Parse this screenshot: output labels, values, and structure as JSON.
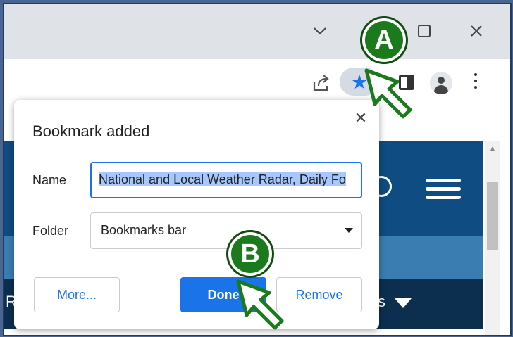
{
  "window": {
    "controls": {
      "collapse_icon": "chevron-down-icon",
      "maximize_icon": "square-icon",
      "close_icon": "close-icon"
    }
  },
  "toolbar": {
    "icons": [
      "share-icon",
      "star-icon",
      "side-panel-icon",
      "profile-icon",
      "more-vert-icon"
    ]
  },
  "page": {
    "nav_left_text": "Ra",
    "nav_right_text": "s"
  },
  "dialog": {
    "title": "Bookmark added",
    "name_label": "Name",
    "name_value": "National and Local Weather Radar, Daily Fo",
    "folder_label": "Folder",
    "folder_value": "Bookmarks bar",
    "buttons": {
      "more": "More...",
      "done": "Done",
      "remove": "Remove"
    }
  },
  "annotations": {
    "a_label": "A",
    "b_label": "B"
  },
  "colors": {
    "accent": "#1a73e8",
    "badge_green": "#1b7a1b",
    "site_header": "#0f4c81",
    "site_nav": "#0c2f50"
  }
}
